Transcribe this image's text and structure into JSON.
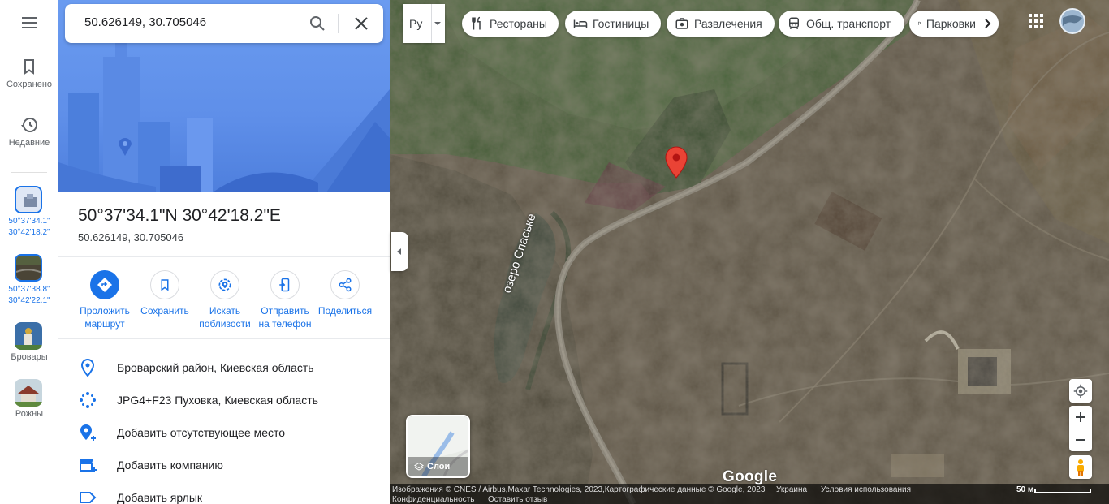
{
  "search": {
    "value": "50.626149, 30.705046"
  },
  "rail": {
    "saved_label": "Сохранено",
    "recent_label": "Недавние",
    "recent_items": [
      {
        "coord_line1": "50°37'34.1\"",
        "coord_line2": "30°42'18.2\""
      },
      {
        "coord_line1": "50°37'38.8\"",
        "coord_line2": "30°42'22.1\""
      }
    ],
    "places": [
      {
        "label": "Бровары"
      },
      {
        "label": "Рожны"
      }
    ]
  },
  "place": {
    "title": "50°37'34.1\"N 30°42'18.2\"E",
    "coords": "50.626149, 30.705046"
  },
  "actions": {
    "directions_1": "Проложить",
    "directions_2": "маршрут",
    "save": "Сохранить",
    "nearby_1": "Искать",
    "nearby_2": "поблизости",
    "send_1": "Отправить",
    "send_2": "на телефон",
    "share": "Поделиться"
  },
  "info": {
    "address": "Броварский район, Киевская область",
    "plus_code": "JPG4+F23 Пуховка, Киевская область",
    "add_place": "Добавить отсутствующее место",
    "add_business": "Добавить компанию",
    "add_label": "Добавить ярлык"
  },
  "map": {
    "lang_label": "Ру",
    "chips": {
      "restaurants": "Рестораны",
      "hotels": "Гостиницы",
      "entertainment": "Развлечения",
      "transit": "Общ. транспорт",
      "parking": "Парковки"
    },
    "lake_label": "озеро Спаське",
    "layers_label": "Слои",
    "google_logo": "Google",
    "attribution": "Изображения © CNES / Airbus,Maxar Technologies, 2023,Картографические данные © Google, 2023",
    "country": "Украина",
    "terms": "Условия использования",
    "privacy": "Конфиденциальность",
    "feedback": "Оставить отзыв",
    "scale": "50 м"
  },
  "colors": {
    "accent": "#1a73e8",
    "pin": "#ea4335",
    "hero": "#5f8fe9"
  }
}
